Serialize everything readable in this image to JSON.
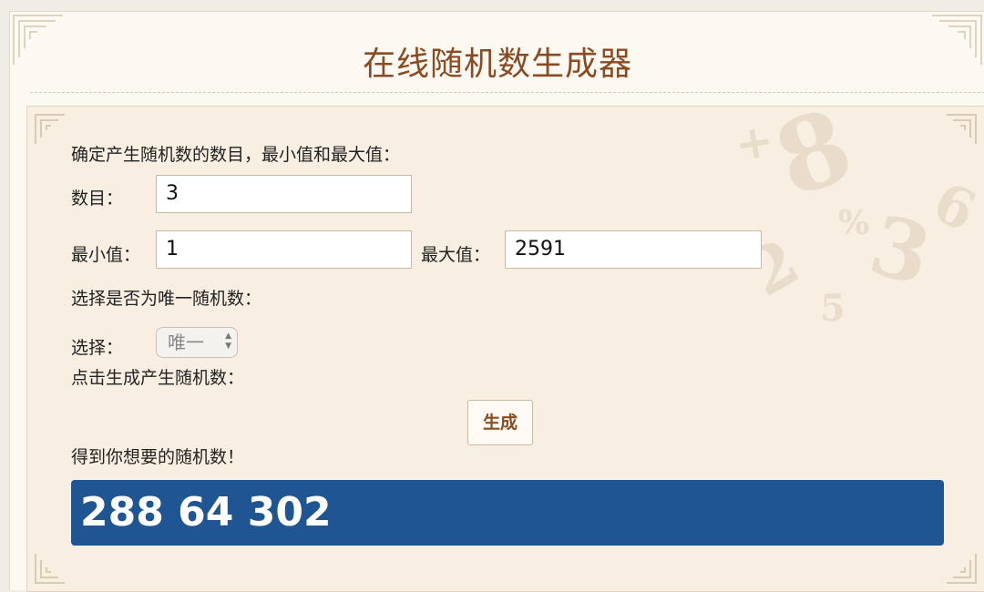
{
  "header": {
    "title": "在线随机数生成器"
  },
  "form": {
    "intro": "确定产生随机数的数目，最小值和最大值：",
    "count_label": "数目：",
    "count_value": "3",
    "min_label": "最小值：",
    "min_value": "1",
    "max_label": "最大值：",
    "max_value": "2591",
    "unique_prompt": "选择是否为唯一随机数：",
    "select_label": "选择：",
    "select_value": "唯一",
    "generate_prompt": "点击生成产生随机数：",
    "generate_button": "生成",
    "result_label": "得到你想要的随机数！",
    "result_value": "288 64 302"
  },
  "colors": {
    "title": "#8a4a22",
    "panel_bg": "#f8efe2",
    "result_bg": "#1f5592"
  }
}
